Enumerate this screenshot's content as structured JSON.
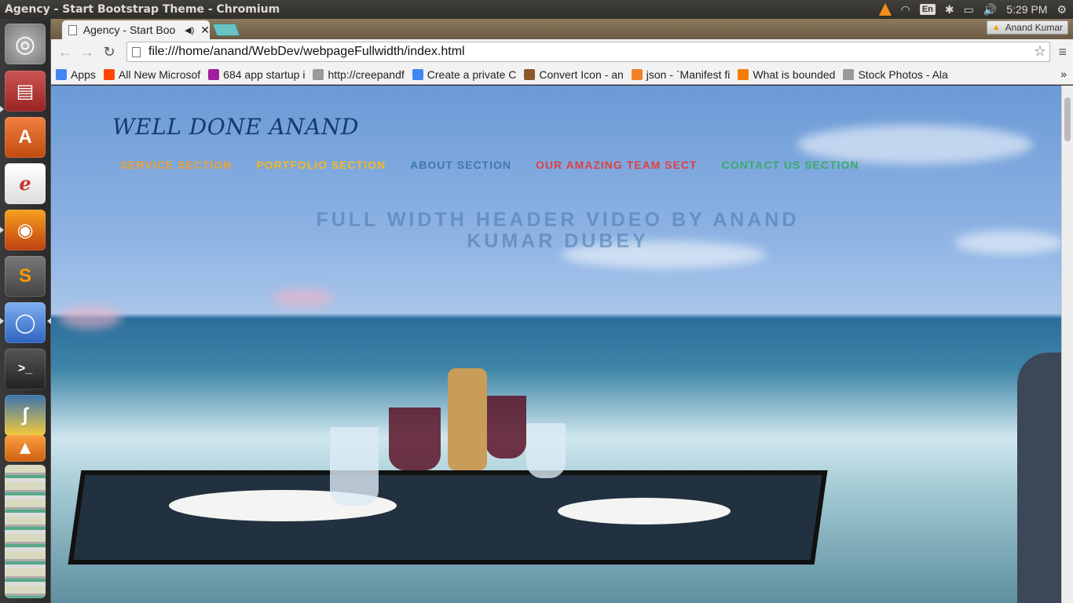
{
  "panel": {
    "window_title": "Agency - Start Bootstrap Theme - Chromium",
    "lang": "En",
    "clock": "5:29 PM"
  },
  "launcher": {
    "items": [
      "ubuntu-dash",
      "files",
      "software-center",
      "document-viewer",
      "firefox",
      "sublime-text",
      "chromium",
      "terminal",
      "python",
      "vlc"
    ]
  },
  "browser": {
    "tab_title": "Agency - Start Boo",
    "profile_name": "Anand Kumar",
    "url": "file:///home/anand/WebDev/webpageFullwidth/index.html",
    "bookmarks": [
      {
        "label": "Apps",
        "icon": "apps-icon",
        "color": "#4285f4"
      },
      {
        "label": "All New Microsof",
        "icon": "reddit-icon",
        "color": "#ff4500"
      },
      {
        "label": "684 app startup i",
        "icon": "ideas-icon",
        "color": "#a020a0"
      },
      {
        "label": "http://creepandf",
        "icon": "page-icon",
        "color": "#999999"
      },
      {
        "label": "Create a private C",
        "icon": "google-icon",
        "color": "#4285f4"
      },
      {
        "label": "Convert Icon - an",
        "icon": "owl-icon",
        "color": "#8b5a2b"
      },
      {
        "label": "json - `Manifest fi",
        "icon": "stackoverflow-icon",
        "color": "#f48024"
      },
      {
        "label": "What is bounded",
        "icon": "blogger-icon",
        "color": "#f57d00"
      },
      {
        "label": "Stock Photos - Ala",
        "icon": "page-icon",
        "color": "#999999"
      }
    ]
  },
  "site": {
    "brand": "WELL DONE ANAND",
    "nav": [
      {
        "label": "SERVICE SECTION",
        "color": "#f0a030"
      },
      {
        "label": "PORTFOLIO SECTION",
        "color": "#f5b622"
      },
      {
        "label": "ABOUT SECTION",
        "color": "#3f78b0"
      },
      {
        "label": "OUR AMAZING TEAM SECT",
        "color": "#e04040"
      },
      {
        "label": "CONTACT US SECTION",
        "color": "#3aaa6a"
      }
    ],
    "hero_heading": "FULL WIDTH HEADER VIDEO BY ANAND KUMAR DUBEY"
  }
}
